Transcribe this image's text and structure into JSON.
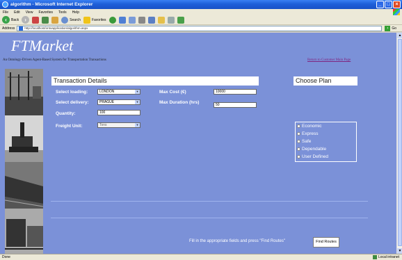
{
  "window": {
    "title": "algorithm - Microsoft Internet Explorer"
  },
  "menu": [
    "File",
    "Edit",
    "View",
    "Favorites",
    "Tools",
    "Help"
  ],
  "toolbar": {
    "back": "Back",
    "search": "Search",
    "favorites": "Favorites"
  },
  "address": {
    "label": "Address",
    "url": "http://localhost/ontoapplication/algorithm.aspx",
    "go": "Go"
  },
  "status": {
    "left": "Done",
    "zone": "Local intranet"
  },
  "page": {
    "logo": "FTMarket",
    "subtitle": "An Ontology-Driven Agent-Based System for Transportation Transactions",
    "return_link": "Return to Customer Main Page",
    "transaction": {
      "title": "Transaction Details",
      "loading_label": "Select loading:",
      "loading_value": "LONDON",
      "delivery_label": "Select delivery:",
      "delivery_value": "PRAGUE",
      "quantity_label": "Quantity:",
      "quantity_value": "100",
      "freight_label": "Freight Unit:",
      "freight_value": "Tons",
      "max_cost_label": "Max Cost (€)",
      "max_cost_value": "10000",
      "max_duration_label": "Max Duration (hrs)",
      "max_duration_value": "50"
    },
    "plan": {
      "title": "Choose Plan",
      "options": [
        "Economic",
        "Express",
        "Safe",
        "Dependable",
        "User Defined"
      ]
    },
    "hint": "Fill in the appropriate fields and press \"Find Routes\"",
    "find_button": "Find Routes"
  }
}
